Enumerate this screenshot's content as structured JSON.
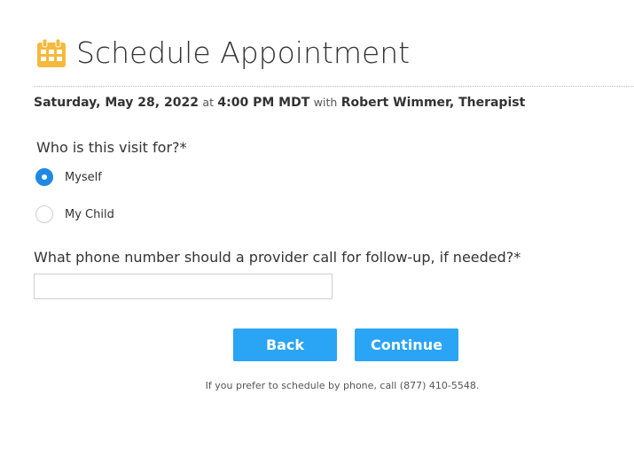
{
  "header": {
    "title": "Schedule Appointment",
    "icon": "calendar-icon",
    "icon_color": "#f5b93b"
  },
  "appointment": {
    "date": "Saturday, May 28, 2022",
    "at": "at",
    "time": "4:00 PM MDT",
    "with": "with",
    "provider": "Robert Wimmer, Therapist"
  },
  "visit_for": {
    "question": "Who is this visit for?*",
    "options": [
      {
        "label": "Myself",
        "selected": true
      },
      {
        "label": "My Child",
        "selected": false
      }
    ]
  },
  "phone": {
    "question": "What phone number should a provider call for follow-up, if needed?*",
    "value": "",
    "placeholder": ""
  },
  "actions": {
    "back_label": "Back",
    "continue_label": "Continue",
    "button_color": "#2aa4f4"
  },
  "footer": {
    "note": "If you prefer to schedule by phone, call (877) 410-5548."
  },
  "colors": {
    "radio_selected": "#1f88e5"
  }
}
